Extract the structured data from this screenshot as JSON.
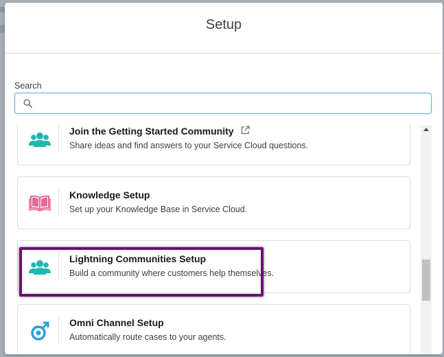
{
  "modal": {
    "title": "Setup"
  },
  "search": {
    "label": "Search",
    "value": "",
    "placeholder": ""
  },
  "items": [
    {
      "title": "Join the Getting Started Community",
      "description": "Share ideas and find answers to your Service Cloud questions.",
      "icon": "community-people-icon",
      "icon_color": "#1fb6b0",
      "external_link": true
    },
    {
      "title": "Knowledge Setup",
      "description": "Set up your Knowledge Base in Service Cloud.",
      "icon": "open-book-icon",
      "icon_color": "#e56798",
      "highlighted": true
    },
    {
      "title": "Lightning Communities Setup",
      "description": "Build a community where customers help themselves.",
      "icon": "community-people-icon",
      "icon_color": "#1fb6b0"
    },
    {
      "title": "Omni Channel Setup",
      "description": "Automatically route cases to your agents.",
      "icon": "omni-channel-icon",
      "icon_color": "#2b9ed9"
    }
  ],
  "colors": {
    "highlight_border": "#6b0f73",
    "search_focus_border": "#5eb4d6"
  }
}
